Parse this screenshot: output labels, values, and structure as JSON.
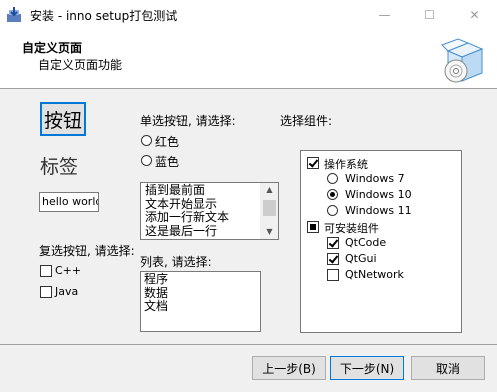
{
  "window": {
    "title": "安装 - inno setup打包测试",
    "minimize_icon": "minimize-icon",
    "maximize_icon": "maximize-icon",
    "close_icon": "close-icon"
  },
  "header": {
    "title": "自定义页面",
    "subtitle": "自定义页面功能",
    "image_icon": "install-box-disc-icon"
  },
  "controls": {
    "big_button_label": "按钮",
    "big_label": "标签",
    "textbox_value": "hello world",
    "radio_group_label": "单选按钮, 请选择:",
    "radios": [
      {
        "label": "红色",
        "selected": false
      },
      {
        "label": "蓝色",
        "selected": false
      }
    ],
    "memo_lines": [
      "插到最前面",
      "文本开始显示",
      "添加一行新文本",
      "这是最后一行"
    ],
    "checkbox_group_label": "复选按钮, 请选择:",
    "checkboxes": [
      {
        "label": "C++",
        "checked": false
      },
      {
        "label": "Java",
        "checked": false
      }
    ],
    "list_label": "列表, 请选择:",
    "list_items": [
      "程序",
      "数据",
      "文档"
    ],
    "components_label": "选择组件:",
    "components": {
      "group1": {
        "label": "操作系统",
        "state": "checked"
      },
      "os_options": [
        {
          "label": "Windows 7",
          "selected": false
        },
        {
          "label": "Windows 10",
          "selected": true
        },
        {
          "label": "Windows 11",
          "selected": false
        }
      ],
      "group2": {
        "label": "可安装组件",
        "state": "partial"
      },
      "items": [
        {
          "label": "QtCode",
          "checked": true
        },
        {
          "label": "QtGui",
          "checked": true
        },
        {
          "label": "QtNetwork",
          "checked": false
        }
      ]
    }
  },
  "footer": {
    "back_label": "上一步(B)",
    "next_label": "下一步(N)",
    "cancel_label": "取消"
  },
  "colors": {
    "focus_border": "#0078d7",
    "window_bg": "#f0f0f0"
  }
}
